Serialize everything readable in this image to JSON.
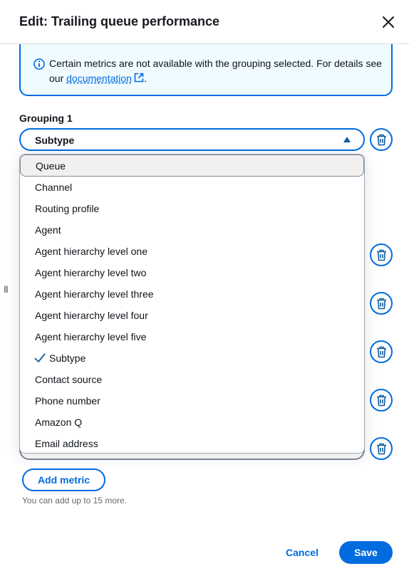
{
  "modal": {
    "title": "Edit: Trailing queue performance",
    "close_icon": "close-icon"
  },
  "info": {
    "text_before": "Certain metrics are not available with the grouping selected. For details see our ",
    "link_text": "documentation",
    "text_after": "."
  },
  "grouping": {
    "label": "Grouping 1",
    "selected_value": "Subtype",
    "options": [
      "Queue",
      "Channel",
      "Routing profile",
      "Agent",
      "Agent hierarchy level one",
      "Agent hierarchy level two",
      "Agent hierarchy level three",
      "Agent hierarchy level four",
      "Agent hierarchy level five",
      "Subtype",
      "Contact source",
      "Phone number",
      "Amazon Q",
      "Email address"
    ],
    "highlighted_option": "Queue"
  },
  "drag_handle": "II",
  "actions": {
    "add_metric_label": "Add metric",
    "hint": "You can add up to 15 more.",
    "cancel_label": "Cancel",
    "save_label": "Save"
  },
  "colors": {
    "accent": "#006ce0",
    "info_bg": "#f0fbff",
    "highlight_bg": "#f1f0ef"
  }
}
